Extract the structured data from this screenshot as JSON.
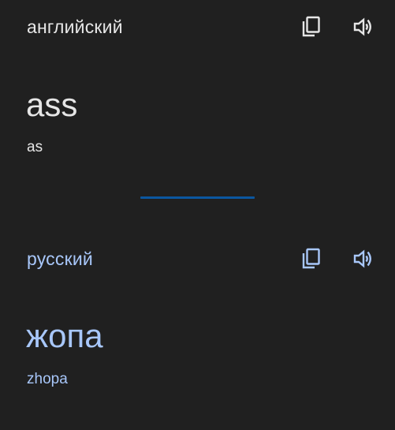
{
  "colors": {
    "background": "#202020",
    "source_text": "#e6e6e6",
    "target_text": "#a8c7fa",
    "divider": "#0b57a0"
  },
  "source": {
    "language": "английский",
    "text": "ass",
    "transliteration": "as",
    "copy_icon": "copy-icon",
    "speak_icon": "volume-icon"
  },
  "target": {
    "language": "русский",
    "text": "жопа",
    "transliteration": "zhopa",
    "copy_icon": "copy-icon",
    "speak_icon": "volume-icon"
  }
}
